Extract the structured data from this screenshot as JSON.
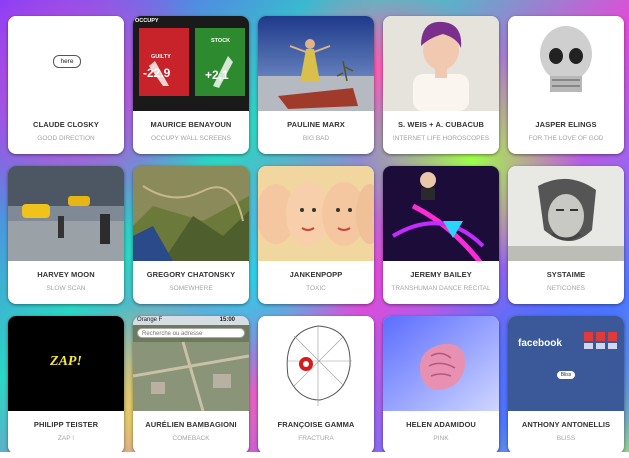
{
  "cards": [
    {
      "artist": "CLAUDE CLOSKY",
      "work": "GOOD DIRECTION",
      "thumb": "white-page"
    },
    {
      "artist": "MAURICE BENAYOUN",
      "work": "OCCUPY WALL SCREENS",
      "thumb": "stock-screens"
    },
    {
      "artist": "PAULINE MARX",
      "work": "BIG BAD",
      "thumb": "dancer"
    },
    {
      "artist": "S. WEIS + A. CUBACUB",
      "work": "INTERNET LIFE HOROSCOPES",
      "thumb": "portrait"
    },
    {
      "artist": "JASPER ELINGS",
      "work": "FOR THE LOVE OF GOD",
      "thumb": "skull"
    },
    {
      "artist": "HARVEY MOON",
      "work": "SLOW SCAN",
      "thumb": "street"
    },
    {
      "artist": "GREGORY CHATONSKY",
      "work": "SOMEWHERE",
      "thumb": "terrain"
    },
    {
      "artist": "JANKENPOPP",
      "work": "TOXIC",
      "thumb": "faces"
    },
    {
      "artist": "JEREMY BAILEY",
      "work": "TRANSHUMAN DANCE RECITAL",
      "thumb": "neon"
    },
    {
      "artist": "SYSTAIME",
      "work": "NETICONES",
      "thumb": "che"
    },
    {
      "artist": "PHILIPP TEISTER",
      "work": "ZAP !",
      "thumb": "zap"
    },
    {
      "artist": "AURÉLIEN BAMBAGIONI",
      "work": "COMEBACK",
      "thumb": "ios-map"
    },
    {
      "artist": "FRANÇOISE GAMMA",
      "work": "FRACTURA",
      "thumb": "wire-head"
    },
    {
      "artist": "HELEN ADAMIDOU",
      "work": "PINK",
      "thumb": "pink-shell"
    },
    {
      "artist": "ANTHONY ANTONELLIS",
      "work": "BLISS",
      "thumb": "facebook"
    }
  ],
  "thumb_text": {
    "here": "here",
    "stock_header": "OCCUPY",
    "stock_left_label": "GUILTY",
    "stock_left_value": "-22.9",
    "stock_right_label": "STOCK",
    "stock_right_value": "+2,1",
    "zap": "ZAP!",
    "ios_carrier": "Orange F",
    "ios_time": "15:00",
    "ios_search_placeholder": "Recherche ou adresse",
    "facebook": "facebook",
    "facebook_button": "Bliss"
  },
  "colors": {
    "card_bg": "#ffffff",
    "artist_text": "#333333",
    "work_text": "#a5a5a5",
    "facebook_blue": "#3b5998"
  }
}
